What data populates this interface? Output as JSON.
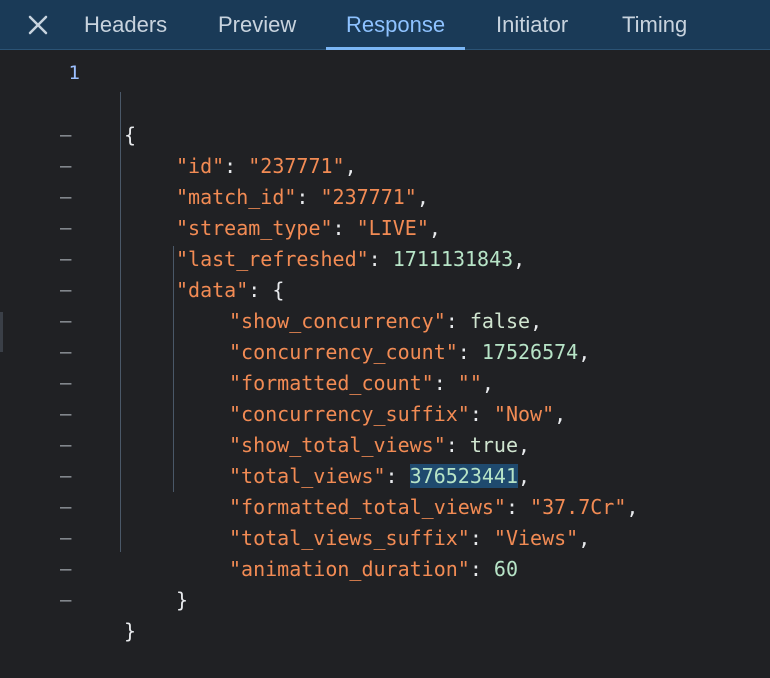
{
  "tabs": {
    "close_label": "×",
    "headers": "Headers",
    "preview": "Preview",
    "response": "Response",
    "initiator": "Initiator",
    "timing": "Timing",
    "active": "Response"
  },
  "gutter": {
    "first": "1",
    "fold": "–"
  },
  "code": {
    "open_brace": "{",
    "id_key": "\"id\"",
    "id_val": "\"237771\"",
    "match_id_key": "\"match_id\"",
    "match_id_val": "\"237771\"",
    "stream_type_key": "\"stream_type\"",
    "stream_type_val": "\"LIVE\"",
    "last_refreshed_key": "\"last_refreshed\"",
    "last_refreshed_val": "1711131843",
    "data_key": "\"data\"",
    "show_concurrency_key": "\"show_concurrency\"",
    "show_concurrency_val": "false",
    "concurrency_count_key": "\"concurrency_count\"",
    "concurrency_count_val": "17526574",
    "formatted_count_key": "\"formatted_count\"",
    "formatted_count_val": "\"\"",
    "concurrency_suffix_key": "\"concurrency_suffix\"",
    "concurrency_suffix_val": "\"Now\"",
    "show_total_views_key": "\"show_total_views\"",
    "show_total_views_val": "true",
    "total_views_key": "\"total_views\"",
    "total_views_val": "376523441",
    "formatted_total_views_key": "\"formatted_total_views\"",
    "formatted_total_views_val": "\"37.7Cr\"",
    "total_views_suffix_key": "\"total_views_suffix\"",
    "total_views_suffix_val": "\"Views\"",
    "animation_duration_key": "\"animation_duration\"",
    "animation_duration_val": "60",
    "close_inner": "}",
    "close_outer": "}"
  },
  "colors": {
    "tabbar_bg": "#1a3a57",
    "editor_bg": "#202124",
    "key": "#f28b54",
    "number": "#b7e4c7",
    "selection": "#1f4a6e",
    "active_tab": "#8ec2ff"
  },
  "icons": {
    "close": "close-icon"
  }
}
